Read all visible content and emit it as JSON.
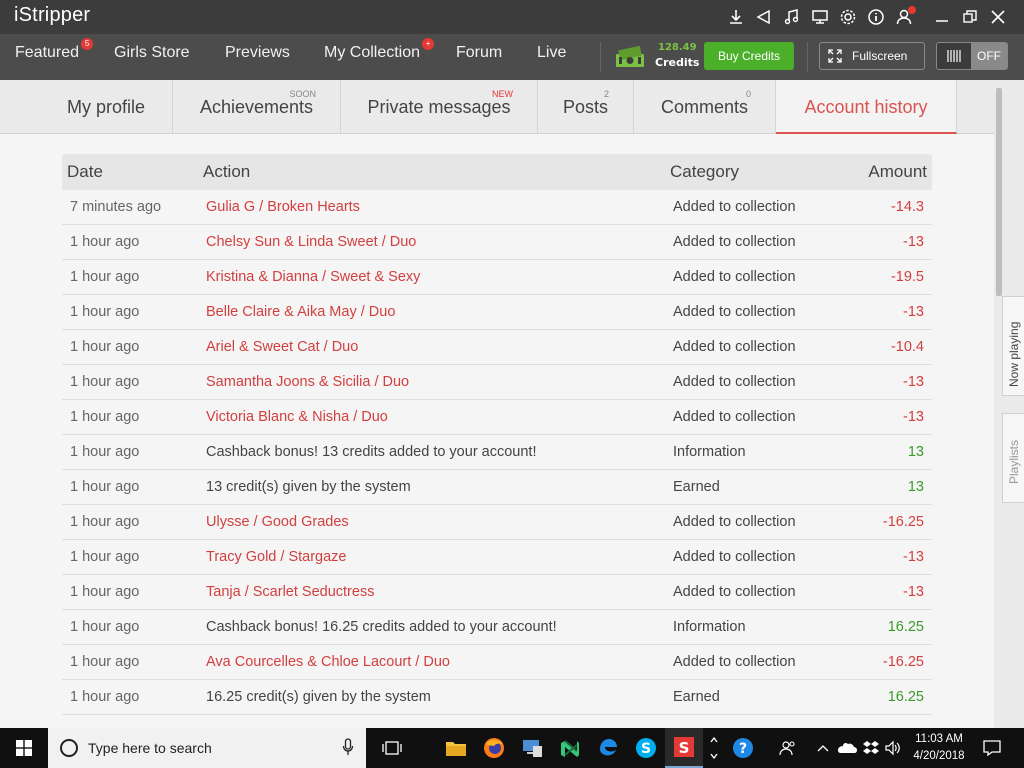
{
  "app": {
    "logo": "iStripper"
  },
  "nav": {
    "featured": "Featured",
    "featured_badge": "5",
    "girls_store": "Girls Store",
    "previews": "Previews",
    "my_collection": "My Collection",
    "my_collection_badge": "+",
    "forum": "Forum",
    "live": "Live",
    "credits_amount": "128.49",
    "credits_label": "Credits",
    "buy_credits": "Buy Credits",
    "fullscreen": "Fullscreen",
    "toggle_state": "OFF"
  },
  "subtabs": [
    {
      "label": "My profile",
      "mini": ""
    },
    {
      "label": "Achievements",
      "mini": "SOON"
    },
    {
      "label": "Private messages",
      "mini": "NEW"
    },
    {
      "label": "Posts",
      "mini": "2"
    },
    {
      "label": "Comments",
      "mini": "0"
    },
    {
      "label": "Account history",
      "mini": ""
    }
  ],
  "table": {
    "headers": {
      "date": "Date",
      "action": "Action",
      "category": "Category",
      "amount": "Amount"
    },
    "rows": [
      {
        "date": "7 minutes ago",
        "action": "Gulia G / Broken Hearts",
        "category": "Added to collection",
        "amount": "-14.3",
        "link": true
      },
      {
        "date": "1 hour ago",
        "action": "Chelsy Sun & Linda Sweet / Duo",
        "category": "Added to collection",
        "amount": "-13",
        "link": true
      },
      {
        "date": "1 hour ago",
        "action": "Kristina & Dianna / Sweet & Sexy",
        "category": "Added to collection",
        "amount": "-19.5",
        "link": true
      },
      {
        "date": "1 hour ago",
        "action": "Belle Claire & Aika May / Duo",
        "category": "Added to collection",
        "amount": "-13",
        "link": true
      },
      {
        "date": "1 hour ago",
        "action": "Ariel & Sweet Cat / Duo",
        "category": "Added to collection",
        "amount": "-10.4",
        "link": true
      },
      {
        "date": "1 hour ago",
        "action": "Samantha Joons & Sicilia / Duo",
        "category": "Added to collection",
        "amount": "-13",
        "link": true
      },
      {
        "date": "1 hour ago",
        "action": "Victoria Blanc & Nisha / Duo",
        "category": "Added to collection",
        "amount": "-13",
        "link": true
      },
      {
        "date": "1 hour ago",
        "action": "Cashback bonus! 13 credits added to your account!",
        "category": "Information",
        "amount": "13",
        "link": false
      },
      {
        "date": "1 hour ago",
        "action": "13 credit(s) given by the system",
        "category": "Earned",
        "amount": "13",
        "link": false
      },
      {
        "date": "1 hour ago",
        "action": "Ulysse / Good Grades",
        "category": "Added to collection",
        "amount": "-16.25",
        "link": true
      },
      {
        "date": "1 hour ago",
        "action": "Tracy Gold / Stargaze",
        "category": "Added to collection",
        "amount": "-13",
        "link": true
      },
      {
        "date": "1 hour ago",
        "action": "Tanja / Scarlet Seductress",
        "category": "Added to collection",
        "amount": "-13",
        "link": true
      },
      {
        "date": "1 hour ago",
        "action": "Cashback bonus! 16.25 credits added to your account!",
        "category": "Information",
        "amount": "16.25",
        "link": false
      },
      {
        "date": "1 hour ago",
        "action": "Ava Courcelles & Chloe Lacourt / Duo",
        "category": "Added to collection",
        "amount": "-16.25",
        "link": true
      },
      {
        "date": "1 hour ago",
        "action": "16.25 credit(s) given by the system",
        "category": "Earned",
        "amount": "16.25",
        "link": false
      }
    ]
  },
  "side": {
    "now_playing": "Now playing",
    "playlists": "Playlists"
  },
  "taskbar": {
    "search_placeholder": "Type here to search",
    "time": "11:03 AM",
    "date": "4/20/2018"
  },
  "colors": {
    "accent_red": "#d23f3f",
    "positive_green": "#3a9a2a",
    "buy_green": "#4caf2a"
  },
  "icons": [
    "download-icon",
    "bell-icon",
    "music-icon",
    "monitor-icon",
    "gear-icon",
    "info-icon",
    "user-icon",
    "minimize-icon",
    "restore-icon",
    "close-icon"
  ]
}
